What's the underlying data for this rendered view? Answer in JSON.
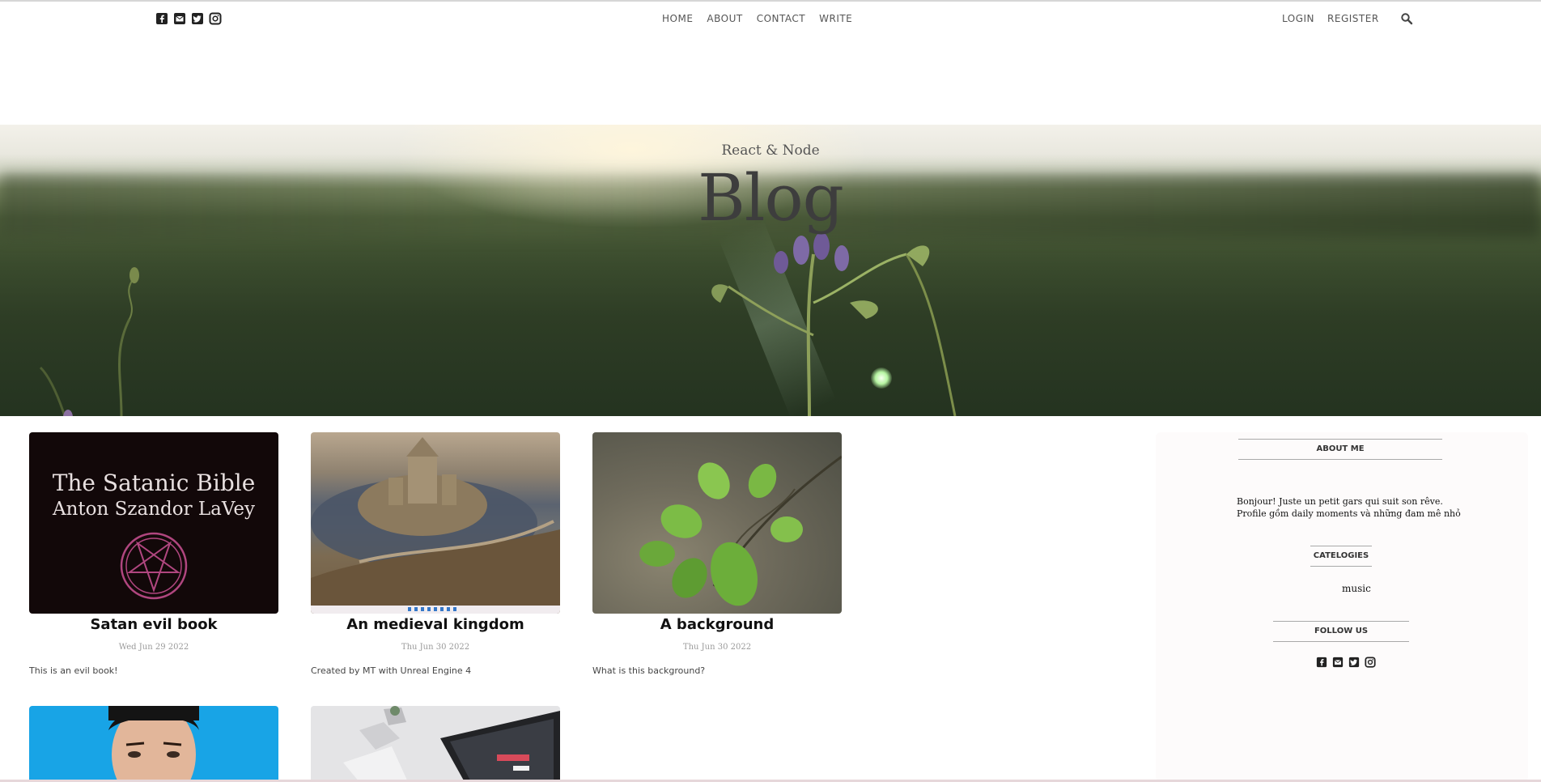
{
  "topbar": {
    "social_icons": [
      "facebook-square-icon",
      "envelope-square-icon",
      "twitter-square-icon",
      "instagram-icon"
    ],
    "nav": {
      "home": "HOME",
      "about": "ABOUT",
      "contact": "CONTACT",
      "write": "WRITE"
    },
    "auth": {
      "login": "LOGIN",
      "register": "REGISTER"
    },
    "search_icon": "search-icon"
  },
  "hero": {
    "subtitle": "React & Node",
    "title": "Blog"
  },
  "posts": [
    {
      "title": "Satan evil book",
      "date": "Wed Jun 29 2022",
      "desc": "This is an evil book!",
      "image_text_line1": "The Satanic Bible",
      "image_text_line2": "Anton Szandor LaVey"
    },
    {
      "title": "An medieval kingdom",
      "date": "Thu Jun 30 2022",
      "desc": "Created by MT with Unreal Engine 4"
    },
    {
      "title": "A background",
      "date": "Thu Jun 30 2022",
      "desc": "What is this background?"
    },
    {},
    {}
  ],
  "sidebar": {
    "about_heading": "ABOUT ME",
    "about_text_line1": "Bonjour! Juste un petit gars qui suit son rêve.",
    "about_text_line2": "Profile gồm daily moments và những đam mê nhỏ",
    "categories_heading": "CATELOGIES",
    "categories": [
      "music"
    ],
    "follow_heading": "FOLLOW US",
    "social_icons": [
      "facebook-square-icon",
      "envelope-square-icon",
      "twitter-square-icon",
      "instagram-icon"
    ]
  },
  "colors": {
    "text_dark": "#111111",
    "nav_text": "#555555",
    "sidebar_bg": "#fdfbfb",
    "divider": "#a9a9a9"
  }
}
